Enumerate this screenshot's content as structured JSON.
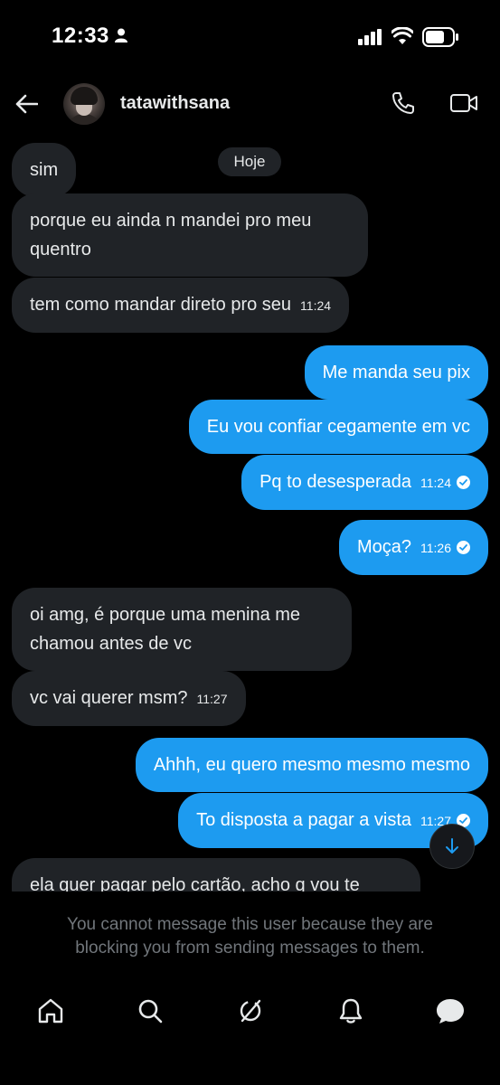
{
  "status_bar": {
    "time": "12:33"
  },
  "header": {
    "username": "tatawithsana"
  },
  "date_separator": "Hoje",
  "messages": [
    {
      "side": "received",
      "text": "sim"
    },
    {
      "side": "received",
      "line1": "porque eu ainda n mandei pro meu",
      "line2": "quentro"
    },
    {
      "side": "received",
      "text": "tem como mandar direto pro seu",
      "time": "11:24"
    },
    {
      "side": "sent",
      "text": "Me manda seu pix"
    },
    {
      "side": "sent",
      "text": "Eu vou confiar cegamente em vc"
    },
    {
      "side": "sent",
      "text": "Pq to desesperada",
      "time": "11:24",
      "status": "read"
    },
    {
      "side": "sent",
      "text": "Moça?",
      "time": "11:26",
      "status": "read"
    },
    {
      "side": "received",
      "line1": "oi amg, é porque uma menina me",
      "line2": "chamou antes de vc"
    },
    {
      "side": "received",
      "text": "vc vai querer msm?",
      "time": "11:27"
    },
    {
      "side": "sent",
      "text": "Ahhh, eu quero mesmo mesmo mesmo"
    },
    {
      "side": "sent",
      "text": "To disposta a pagar a vista",
      "time": "11:27",
      "status": "read"
    },
    {
      "side": "received",
      "text": "ela quer pagar pelo cartão, acho q vou te"
    }
  ],
  "blocked_notice": "You cannot message this user because they are blocking you from sending messages to them.",
  "colors": {
    "background": "#000000",
    "sent_bubble": "#1d9bf0",
    "received_bubble": "#202327",
    "muted_text": "#71767b"
  },
  "icons": {
    "back": "arrow-left-icon",
    "call": "phone-icon",
    "video": "video-camera-icon",
    "scroll": "arrow-down-icon",
    "nav": [
      "home-icon",
      "search-icon",
      "grok-icon",
      "bell-icon",
      "messages-icon"
    ]
  }
}
